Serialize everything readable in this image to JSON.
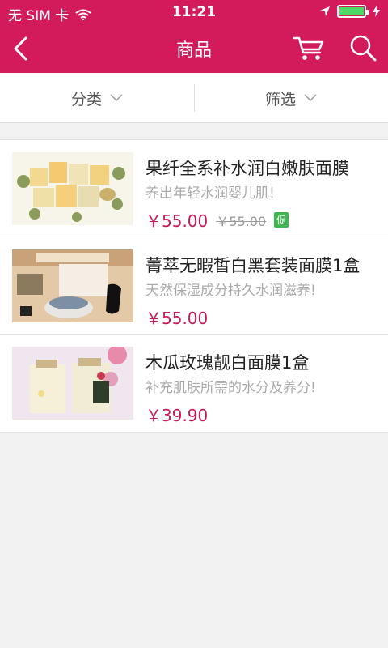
{
  "status_bar": {
    "carrier": "无 SIM 卡",
    "time": "11:21",
    "battery_level": 1.0
  },
  "nav": {
    "title": "商品",
    "back_icon": "back-chevron-icon",
    "cart_icon": "cart-icon",
    "search_icon": "search-icon"
  },
  "filters": {
    "category_label": "分类",
    "filter_label": "筛选"
  },
  "products": [
    {
      "title": "果纤全系补水润白嫩肤面膜",
      "subtitle": "养出年轻水润婴儿肌!",
      "price": "￥55.00",
      "old_price": "￥55.00",
      "promo": "促"
    },
    {
      "title": "菁萃无暇皙白黑套装面膜1盒",
      "subtitle": "天然保湿成分持久水润滋养!",
      "price": "￥55.00"
    },
    {
      "title": "木瓜玫瑰靓白面膜1盒",
      "subtitle": "补充肌肤所需的水分及养分!",
      "price": "￥39.90"
    }
  ],
  "colors": {
    "brand": "#d31b5c",
    "price": "#c7195a",
    "promo": "#3fb550"
  }
}
